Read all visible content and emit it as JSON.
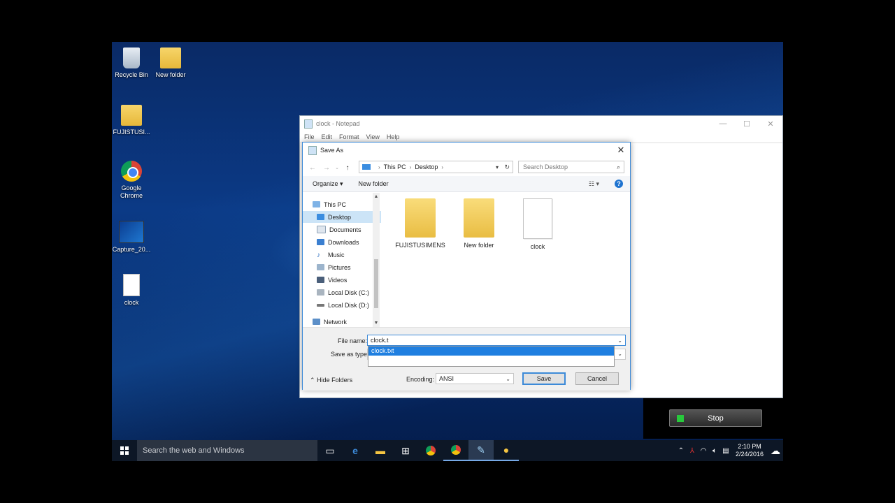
{
  "desktop": {
    "icons": [
      {
        "label": "Recycle Bin",
        "icon": "recycle-bin-icon"
      },
      {
        "label": "New folder",
        "icon": "folder-icon"
      },
      {
        "label": "FUJISTUSI...",
        "icon": "folder-icon"
      },
      {
        "label": "Google Chrome",
        "icon": "chrome-icon"
      },
      {
        "label": "Capture_20...",
        "icon": "video-file-icon"
      },
      {
        "label": "clock",
        "icon": "text-file-icon"
      }
    ]
  },
  "notepad": {
    "title": "clock - Notepad",
    "menu": [
      "File",
      "Edit",
      "Format",
      "View",
      "Help"
    ]
  },
  "dialog": {
    "title": "Save As",
    "breadcrumb": [
      "This PC",
      "Desktop"
    ],
    "search_placeholder": "Search Desktop",
    "organize_label": "Organize ▾",
    "new_folder_label": "New folder",
    "nav_items": [
      "This PC",
      "Desktop",
      "Documents",
      "Downloads",
      "Music",
      "Pictures",
      "Videos",
      "Local Disk (C:)",
      "Local Disk (D:)",
      "Network"
    ],
    "selected_nav": "Desktop",
    "files": [
      {
        "name": "FUJISTUSIMENS",
        "type": "folder"
      },
      {
        "name": "New folder",
        "type": "folder"
      },
      {
        "name": "clock",
        "type": "text"
      }
    ],
    "file_name_label": "File name:",
    "file_name_value": "clock.t",
    "save_as_type_label": "Save as type:",
    "autocomplete_option": "clock.txt",
    "hide_folders_label": "Hide Folders",
    "encoding_label": "Encoding:",
    "encoding_value": "ANSI",
    "save_label": "Save",
    "cancel_label": "Cancel"
  },
  "recorder": {
    "stop_label": "Stop"
  },
  "taskbar": {
    "search_placeholder": "Search the web and Windows",
    "time": "2:10 PM",
    "date": "2/24/2016"
  }
}
